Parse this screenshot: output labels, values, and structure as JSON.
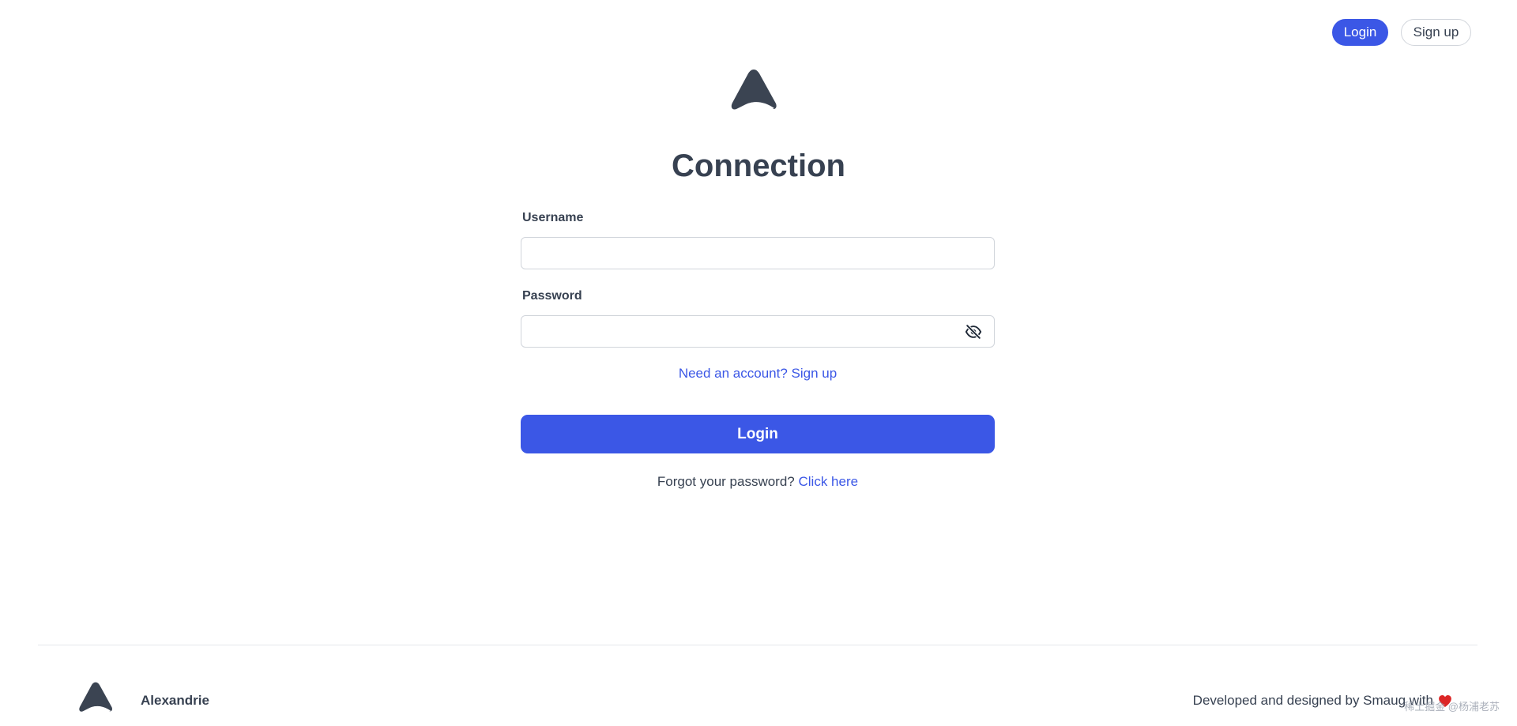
{
  "nav": {
    "login_label": "Login",
    "signup_label": "Sign up"
  },
  "page": {
    "title": "Connection"
  },
  "form": {
    "username_label": "Username",
    "username_value": "",
    "password_label": "Password",
    "password_value": "",
    "signup_prompt": "Need an account? Sign up",
    "submit_label": "Login",
    "forgot_text": "Forgot your password?",
    "forgot_link": "Click here"
  },
  "footer": {
    "brand": "Alexandrie",
    "credit": "Developed and designed by Smaug with",
    "watermark": "稀土掘金 @杨浦老苏"
  },
  "icons": {
    "logo": "alexandrie-logo-icon",
    "password_toggle": "eye-slash-icon",
    "heart": "heart-icon"
  },
  "colors": {
    "accent": "#3b57e6",
    "text": "#374151",
    "border": "#d1d5db",
    "heart": "#dc2626"
  }
}
